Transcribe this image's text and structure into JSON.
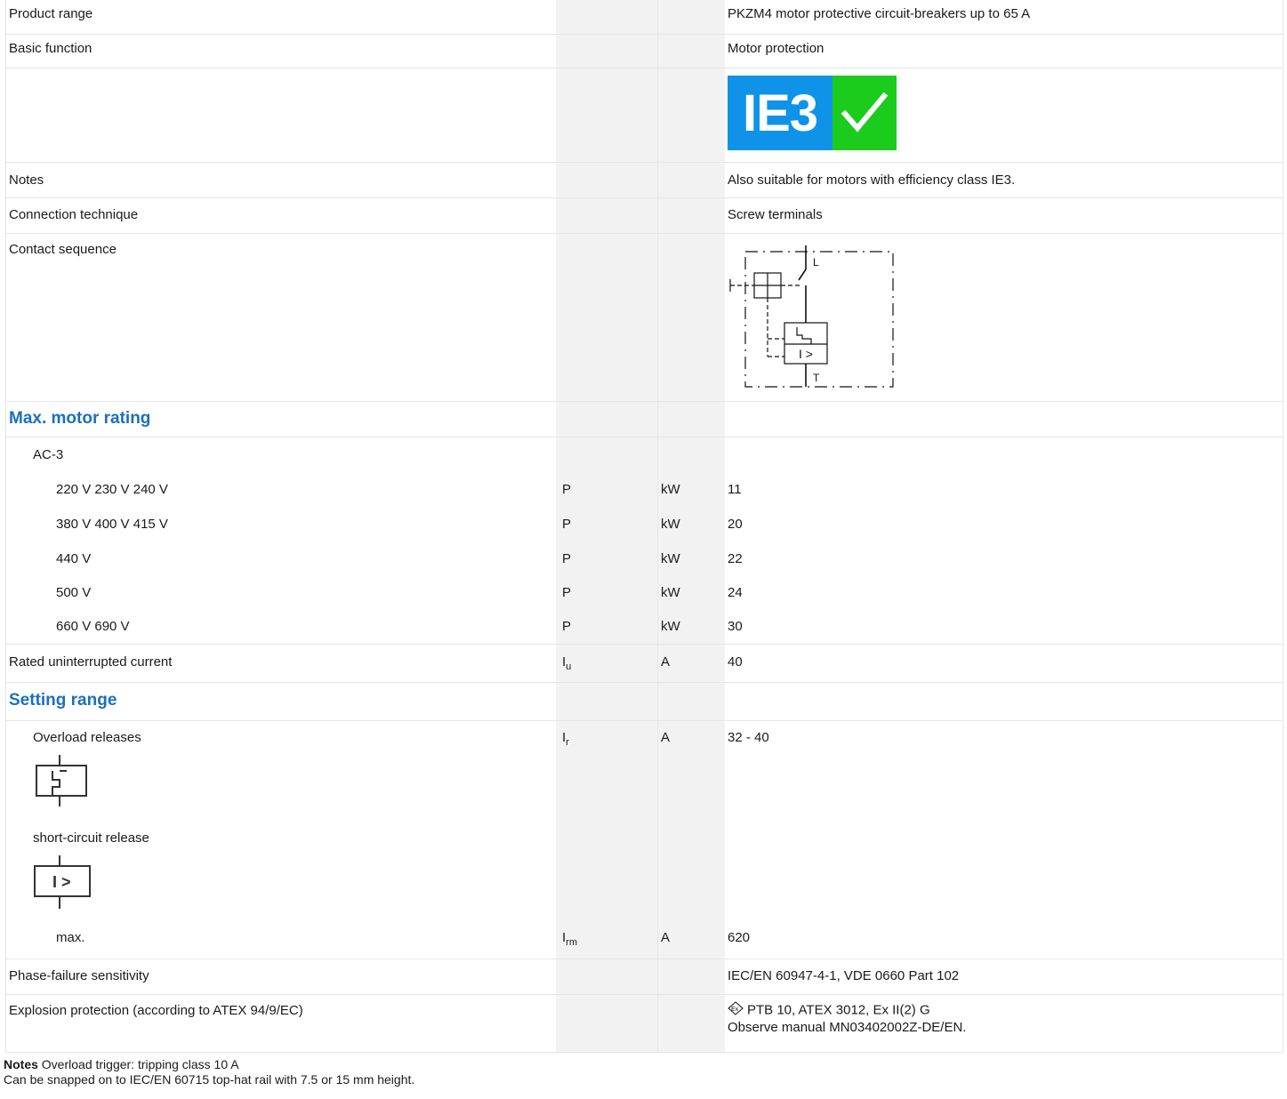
{
  "rows": {
    "product_range": {
      "label": "Product range",
      "value": "PKZM4 motor protective circuit-breakers up to 65 A"
    },
    "basic_function": {
      "label": "Basic function",
      "value": "Motor protection"
    },
    "ie3_badge": {
      "text": "IE3",
      "colors": {
        "blue": "#0f93e8",
        "green": "#1ccc1c"
      }
    },
    "notes": {
      "label": "Notes",
      "value": "Also suitable for motors with efficiency class IE3."
    },
    "connection": {
      "label": "Connection technique",
      "value": "Screw terminals"
    },
    "contact_sequence": {
      "label": "Contact sequence",
      "diagram": {
        "top_label": "L",
        "bottom_label": "T",
        "release_label": "I >"
      }
    },
    "max_motor_heading": "Max. motor rating",
    "ac3": "AC-3",
    "ratings": [
      {
        "label": "220 V 230 V 240 V",
        "symbol": "P",
        "unit": "kW",
        "value": "11"
      },
      {
        "label": "380 V 400 V 415 V",
        "symbol": "P",
        "unit": "kW",
        "value": "20"
      },
      {
        "label": "440 V",
        "symbol": "P",
        "unit": "kW",
        "value": "22"
      },
      {
        "label": "500 V",
        "symbol": "P",
        "unit": "kW",
        "value": "24"
      },
      {
        "label": "660 V 690 V",
        "symbol": "P",
        "unit": "kW",
        "value": "30"
      }
    ],
    "rated_current": {
      "label": "Rated uninterrupted current",
      "symbol": "I",
      "symbol_sub": "u",
      "unit": "A",
      "value": "40"
    },
    "setting_heading": "Setting range",
    "overload": {
      "label": "Overload releases",
      "symbol": "I",
      "symbol_sub": "r",
      "unit": "A",
      "value": "32 - 40"
    },
    "short_circuit": {
      "label": "short-circuit release",
      "symbol_text": "I >"
    },
    "max": {
      "label": "max.",
      "symbol": "I",
      "symbol_sub": "rm",
      "unit": "A",
      "value": "620"
    },
    "phase_failure": {
      "label": "Phase-failure sensitivity",
      "value": "IEC/EN 60947-4-1, VDE 0660 Part 102"
    },
    "explosion": {
      "label": "Explosion protection (according to ATEX 94/9/EC)",
      "value_line1": "PTB 10, ATEX 3012, Ex II(2) G",
      "value_line2": "Observe manual MN03402002Z-DE/EN.",
      "ex_symbol": "Ex"
    }
  },
  "footer": {
    "notes_label": "Notes",
    "line1": "Overload trigger: tripping class 10 A",
    "line2": "Can be snapped on to IEC/EN 60715 top-hat rail with 7.5 or 15 mm height."
  }
}
